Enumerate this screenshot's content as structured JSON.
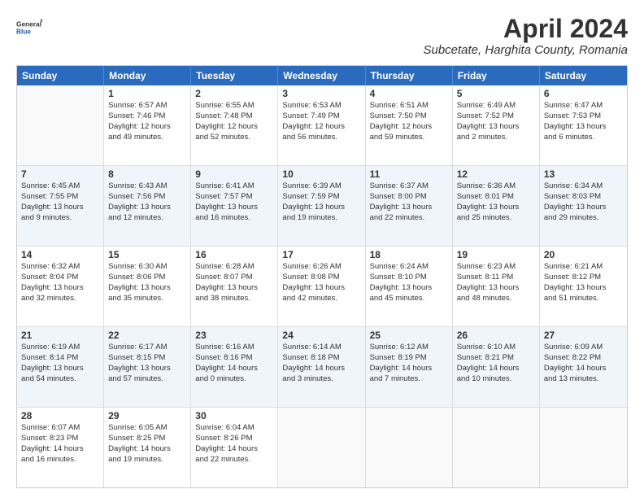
{
  "header": {
    "logo_general": "General",
    "logo_blue": "Blue",
    "title": "April 2024",
    "subtitle": "Subcetate, Harghita County, Romania"
  },
  "days": [
    "Sunday",
    "Monday",
    "Tuesday",
    "Wednesday",
    "Thursday",
    "Friday",
    "Saturday"
  ],
  "weeks": [
    [
      {
        "num": "",
        "lines": []
      },
      {
        "num": "1",
        "lines": [
          "Sunrise: 6:57 AM",
          "Sunset: 7:46 PM",
          "Daylight: 12 hours",
          "and 49 minutes."
        ]
      },
      {
        "num": "2",
        "lines": [
          "Sunrise: 6:55 AM",
          "Sunset: 7:48 PM",
          "Daylight: 12 hours",
          "and 52 minutes."
        ]
      },
      {
        "num": "3",
        "lines": [
          "Sunrise: 6:53 AM",
          "Sunset: 7:49 PM",
          "Daylight: 12 hours",
          "and 56 minutes."
        ]
      },
      {
        "num": "4",
        "lines": [
          "Sunrise: 6:51 AM",
          "Sunset: 7:50 PM",
          "Daylight: 12 hours",
          "and 59 minutes."
        ]
      },
      {
        "num": "5",
        "lines": [
          "Sunrise: 6:49 AM",
          "Sunset: 7:52 PM",
          "Daylight: 13 hours",
          "and 2 minutes."
        ]
      },
      {
        "num": "6",
        "lines": [
          "Sunrise: 6:47 AM",
          "Sunset: 7:53 PM",
          "Daylight: 13 hours",
          "and 6 minutes."
        ]
      }
    ],
    [
      {
        "num": "7",
        "lines": [
          "Sunrise: 6:45 AM",
          "Sunset: 7:55 PM",
          "Daylight: 13 hours",
          "and 9 minutes."
        ]
      },
      {
        "num": "8",
        "lines": [
          "Sunrise: 6:43 AM",
          "Sunset: 7:56 PM",
          "Daylight: 13 hours",
          "and 12 minutes."
        ]
      },
      {
        "num": "9",
        "lines": [
          "Sunrise: 6:41 AM",
          "Sunset: 7:57 PM",
          "Daylight: 13 hours",
          "and 16 minutes."
        ]
      },
      {
        "num": "10",
        "lines": [
          "Sunrise: 6:39 AM",
          "Sunset: 7:59 PM",
          "Daylight: 13 hours",
          "and 19 minutes."
        ]
      },
      {
        "num": "11",
        "lines": [
          "Sunrise: 6:37 AM",
          "Sunset: 8:00 PM",
          "Daylight: 13 hours",
          "and 22 minutes."
        ]
      },
      {
        "num": "12",
        "lines": [
          "Sunrise: 6:36 AM",
          "Sunset: 8:01 PM",
          "Daylight: 13 hours",
          "and 25 minutes."
        ]
      },
      {
        "num": "13",
        "lines": [
          "Sunrise: 6:34 AM",
          "Sunset: 8:03 PM",
          "Daylight: 13 hours",
          "and 29 minutes."
        ]
      }
    ],
    [
      {
        "num": "14",
        "lines": [
          "Sunrise: 6:32 AM",
          "Sunset: 8:04 PM",
          "Daylight: 13 hours",
          "and 32 minutes."
        ]
      },
      {
        "num": "15",
        "lines": [
          "Sunrise: 6:30 AM",
          "Sunset: 8:06 PM",
          "Daylight: 13 hours",
          "and 35 minutes."
        ]
      },
      {
        "num": "16",
        "lines": [
          "Sunrise: 6:28 AM",
          "Sunset: 8:07 PM",
          "Daylight: 13 hours",
          "and 38 minutes."
        ]
      },
      {
        "num": "17",
        "lines": [
          "Sunrise: 6:26 AM",
          "Sunset: 8:08 PM",
          "Daylight: 13 hours",
          "and 42 minutes."
        ]
      },
      {
        "num": "18",
        "lines": [
          "Sunrise: 6:24 AM",
          "Sunset: 8:10 PM",
          "Daylight: 13 hours",
          "and 45 minutes."
        ]
      },
      {
        "num": "19",
        "lines": [
          "Sunrise: 6:23 AM",
          "Sunset: 8:11 PM",
          "Daylight: 13 hours",
          "and 48 minutes."
        ]
      },
      {
        "num": "20",
        "lines": [
          "Sunrise: 6:21 AM",
          "Sunset: 8:12 PM",
          "Daylight: 13 hours",
          "and 51 minutes."
        ]
      }
    ],
    [
      {
        "num": "21",
        "lines": [
          "Sunrise: 6:19 AM",
          "Sunset: 8:14 PM",
          "Daylight: 13 hours",
          "and 54 minutes."
        ]
      },
      {
        "num": "22",
        "lines": [
          "Sunrise: 6:17 AM",
          "Sunset: 8:15 PM",
          "Daylight: 13 hours",
          "and 57 minutes."
        ]
      },
      {
        "num": "23",
        "lines": [
          "Sunrise: 6:16 AM",
          "Sunset: 8:16 PM",
          "Daylight: 14 hours",
          "and 0 minutes."
        ]
      },
      {
        "num": "24",
        "lines": [
          "Sunrise: 6:14 AM",
          "Sunset: 8:18 PM",
          "Daylight: 14 hours",
          "and 3 minutes."
        ]
      },
      {
        "num": "25",
        "lines": [
          "Sunrise: 6:12 AM",
          "Sunset: 8:19 PM",
          "Daylight: 14 hours",
          "and 7 minutes."
        ]
      },
      {
        "num": "26",
        "lines": [
          "Sunrise: 6:10 AM",
          "Sunset: 8:21 PM",
          "Daylight: 14 hours",
          "and 10 minutes."
        ]
      },
      {
        "num": "27",
        "lines": [
          "Sunrise: 6:09 AM",
          "Sunset: 8:22 PM",
          "Daylight: 14 hours",
          "and 13 minutes."
        ]
      }
    ],
    [
      {
        "num": "28",
        "lines": [
          "Sunrise: 6:07 AM",
          "Sunset: 8:23 PM",
          "Daylight: 14 hours",
          "and 16 minutes."
        ]
      },
      {
        "num": "29",
        "lines": [
          "Sunrise: 6:05 AM",
          "Sunset: 8:25 PM",
          "Daylight: 14 hours",
          "and 19 minutes."
        ]
      },
      {
        "num": "30",
        "lines": [
          "Sunrise: 6:04 AM",
          "Sunset: 8:26 PM",
          "Daylight: 14 hours",
          "and 22 minutes."
        ]
      },
      {
        "num": "",
        "lines": []
      },
      {
        "num": "",
        "lines": []
      },
      {
        "num": "",
        "lines": []
      },
      {
        "num": "",
        "lines": []
      }
    ]
  ]
}
